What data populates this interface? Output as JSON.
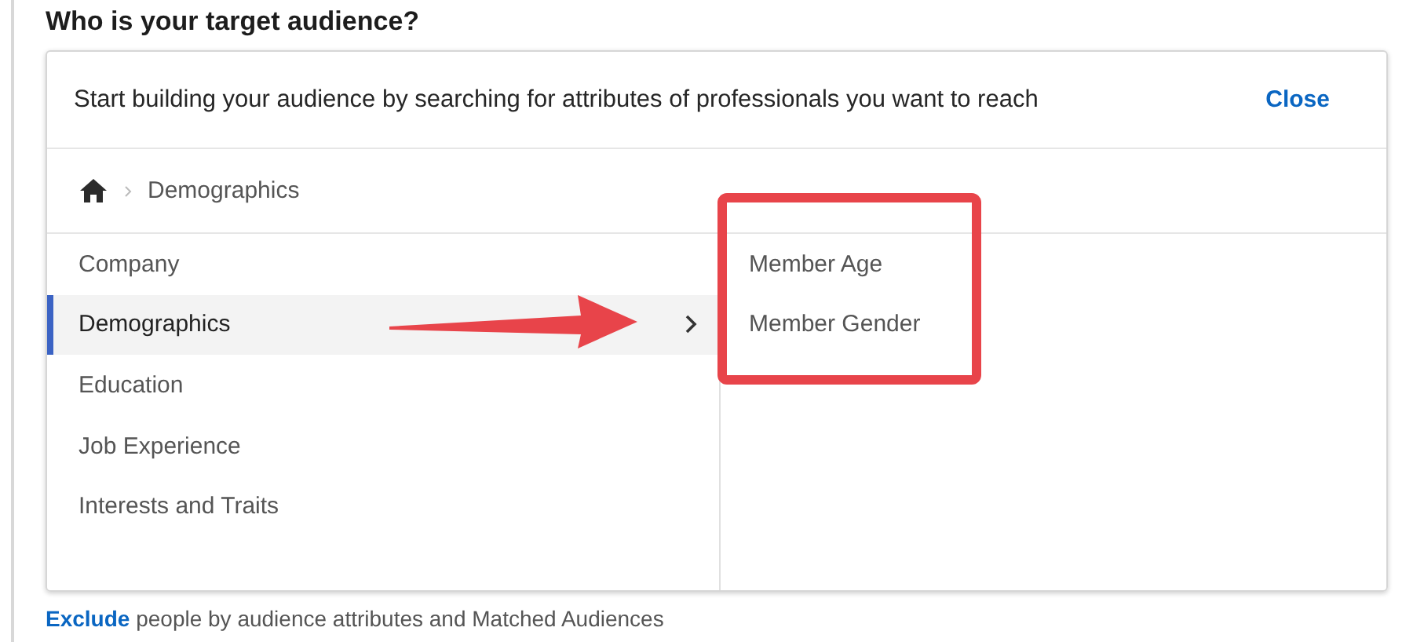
{
  "heading": "Who is your target audience?",
  "panel": {
    "intro": "Start building your audience by searching for attributes of professionals you want to reach",
    "close": "Close",
    "breadcrumb": [
      "Demographics"
    ],
    "categories": [
      {
        "label": "Company",
        "selected": false
      },
      {
        "label": "Demographics",
        "selected": true
      },
      {
        "label": "Education",
        "selected": false
      },
      {
        "label": "Job Experience",
        "selected": false
      },
      {
        "label": "Interests and Traits",
        "selected": false
      }
    ],
    "subcategories": [
      "Member Age",
      "Member Gender"
    ]
  },
  "annotations": {
    "arrow": true,
    "highlight_box": true
  },
  "footer": {
    "link": "Exclude",
    "text": "people by audience attributes and Matched Audiences"
  }
}
